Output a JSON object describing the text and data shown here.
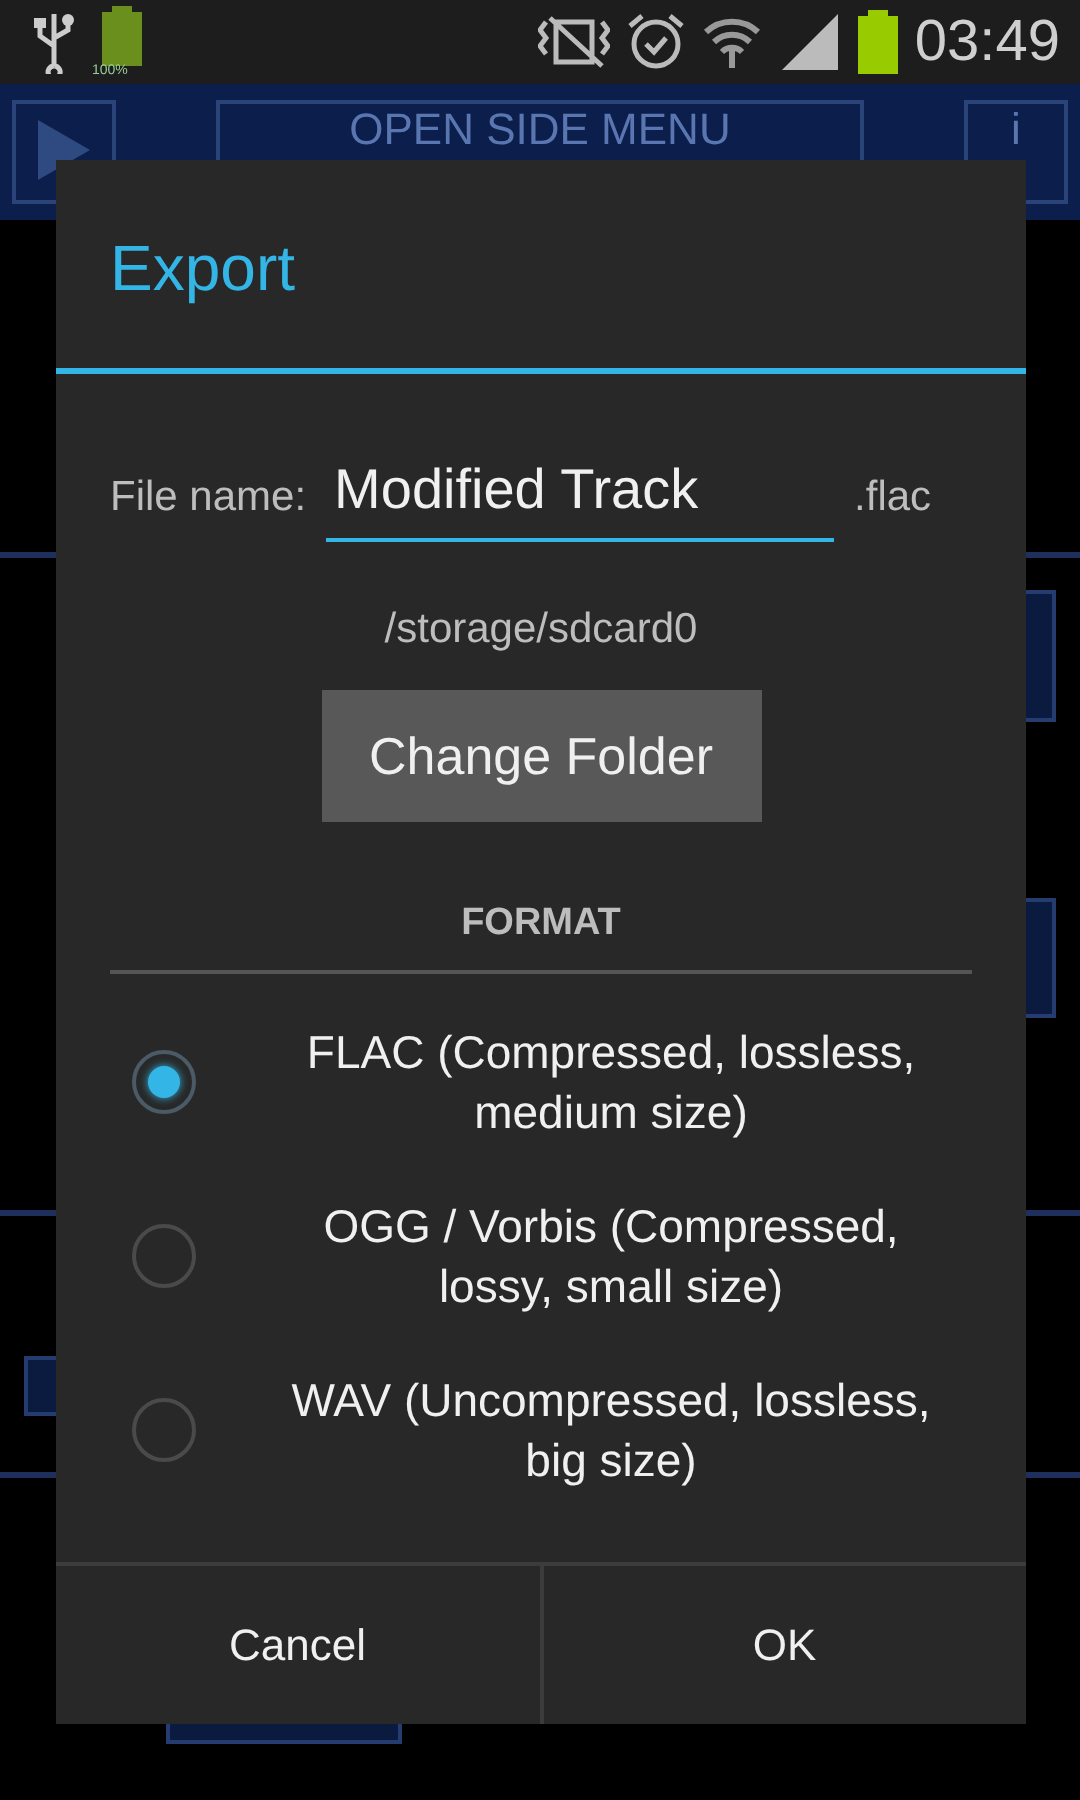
{
  "status_bar": {
    "battery_label": "100%",
    "time": "03:49"
  },
  "app_bar": {
    "side_menu_button": "OPEN SIDE MENU",
    "info_button": "i"
  },
  "dialog": {
    "title": "Export",
    "file_name": {
      "label": "File name:",
      "value": "Modified Track",
      "extension": ".flac"
    },
    "folder_path": "/storage/sdcard0",
    "change_folder_button": "Change Folder",
    "format_header": "FORMAT",
    "formats": [
      {
        "label": "FLAC (Compressed, lossless, medium size)",
        "selected": true
      },
      {
        "label": "OGG / Vorbis (Compressed, lossy, small size)",
        "selected": false
      },
      {
        "label": "WAV (Uncompressed, lossless, big size)",
        "selected": false
      }
    ],
    "buttons": [
      "Cancel",
      "OK"
    ]
  }
}
